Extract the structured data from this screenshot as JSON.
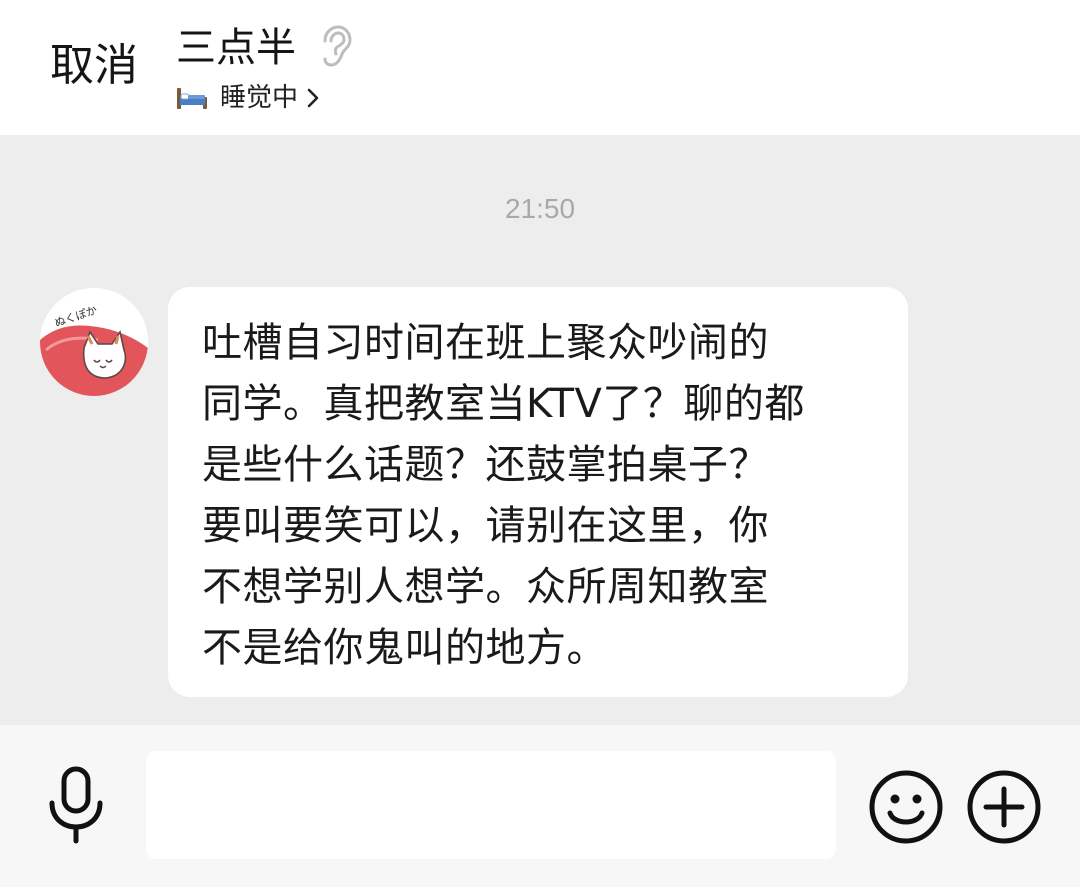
{
  "header": {
    "cancel_label": "取消",
    "contact_name": "三点半",
    "status_icon": "bed-icon",
    "status_text": "睡觉中",
    "status_chevron": "chevron-right-icon",
    "listen_icon": "ear-icon"
  },
  "chat": {
    "timestamp": "21:50",
    "messages": [
      {
        "avatar_icon": "cat-sticker-avatar",
        "avatar_text": "ぬくぽか",
        "text_lines": [
          "吐槽自习时间在班上聚众吵闹的",
          "同学。真把教室当KTV了？聊的都",
          "是些什么话题？还鼓掌拍桌子？",
          "要叫要笑可以，请别在这里，你",
          "不想学别人想学。众所周知教室",
          "不是给你鬼叫的地方。"
        ]
      }
    ]
  },
  "input_bar": {
    "voice_icon": "microphone-icon",
    "input_value": "",
    "emoji_icon": "smiley-icon",
    "more_icon": "plus-circle-icon"
  }
}
